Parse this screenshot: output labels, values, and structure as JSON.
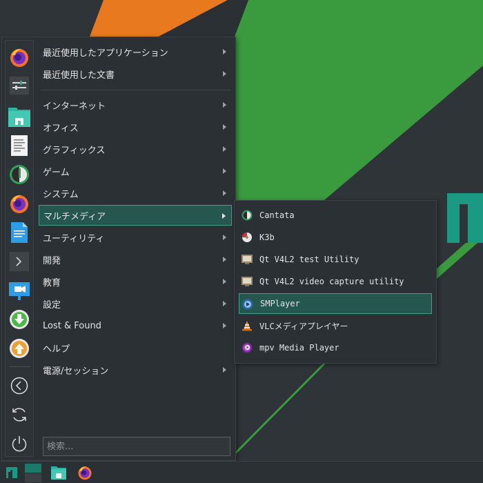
{
  "main_menu": {
    "categories": [
      {
        "label": "最近使用したアプリケーション"
      },
      {
        "label": "最近使用した文書"
      },
      {
        "label": "インターネット"
      },
      {
        "label": "オフィス"
      },
      {
        "label": "グラフィックス"
      },
      {
        "label": "ゲーム"
      },
      {
        "label": "システム"
      },
      {
        "label": "マルチメディア"
      },
      {
        "label": "ユーティリティ"
      },
      {
        "label": "開発"
      },
      {
        "label": "教育"
      },
      {
        "label": "設定"
      },
      {
        "label": "Lost & Found"
      },
      {
        "label": "ヘルプ"
      },
      {
        "label": "電源/セッション"
      }
    ],
    "search_placeholder": "検索..."
  },
  "favorites": [
    "firefox-icon",
    "settings-manager-icon",
    "file-manager-icon",
    "text-editor-icon",
    "cantata-icon",
    "firefox-icon",
    "document-icon",
    "terminal-icon",
    "presentation-icon",
    "download-icon",
    "upload-icon",
    "back-icon",
    "refresh-icon",
    "power-icon"
  ],
  "submenu": {
    "items": [
      {
        "label": "Cantata"
      },
      {
        "label": "K3b"
      },
      {
        "label": "Qt V4L2 test Utility"
      },
      {
        "label": "Qt V4L2 video capture utility"
      },
      {
        "label": "SMPlayer"
      },
      {
        "label": "VLCメディアプレイヤー"
      },
      {
        "label": "mpv Media Player"
      }
    ]
  },
  "colors": {
    "accent": "#26574f",
    "accent_border": "#3fa08e",
    "wallpaper_green": "#3a9a3e",
    "wallpaper_orange": "#e8791e",
    "manjaro_teal": "#1a9a82"
  }
}
